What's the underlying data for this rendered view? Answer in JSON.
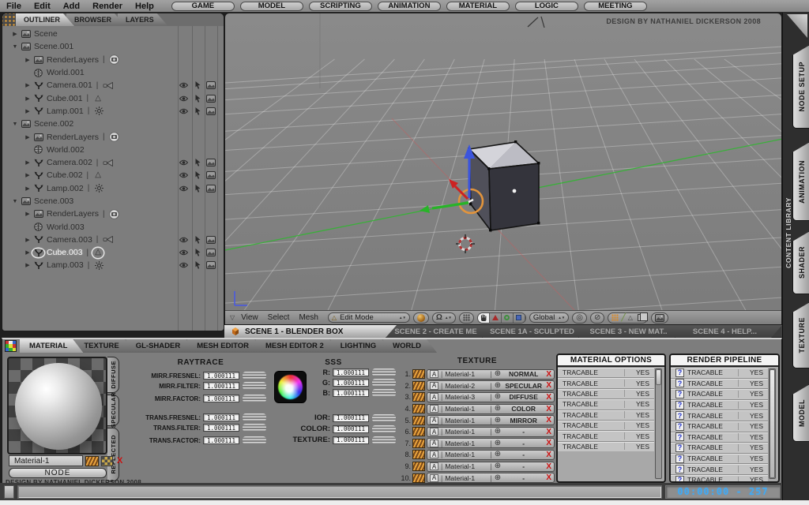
{
  "menubar": {
    "menus": [
      "File",
      "Edit",
      "Add",
      "Render",
      "Help"
    ],
    "workspace_tabs": [
      "GAME",
      "MODEL",
      "SCRIPTING",
      "ANIMATION",
      "MATERIAL",
      "LOGIC",
      "MEETING"
    ]
  },
  "outliner": {
    "tabs": [
      {
        "label": "OUTLINER",
        "active": true
      },
      {
        "label": "BROWSER",
        "active": false
      },
      {
        "label": "LAYERS",
        "active": false
      }
    ],
    "tree": [
      {
        "indent": 0,
        "arrow": "right",
        "icon": "scene",
        "label": "Scene"
      },
      {
        "indent": 0,
        "arrow": "down",
        "icon": "scene",
        "label": "Scene.001"
      },
      {
        "indent": 1,
        "arrow": "right",
        "icon": "scene",
        "label": "RenderLayers",
        "badge": "render"
      },
      {
        "indent": 1,
        "arrow": "none",
        "icon": "world",
        "label": "World.001"
      },
      {
        "indent": 1,
        "arrow": "right",
        "icon": "object",
        "label": "Camera.001",
        "type_icon": "camera",
        "columns": true
      },
      {
        "indent": 1,
        "arrow": "right",
        "icon": "object",
        "label": "Cube.001",
        "type_icon": "mesh",
        "columns": true
      },
      {
        "indent": 1,
        "arrow": "right",
        "icon": "object",
        "label": "Lamp.001",
        "type_icon": "lamp",
        "columns": true
      },
      {
        "indent": 0,
        "arrow": "down",
        "icon": "scene",
        "label": "Scene.002"
      },
      {
        "indent": 1,
        "arrow": "right",
        "icon": "scene",
        "label": "RenderLayers",
        "badge": "render"
      },
      {
        "indent": 1,
        "arrow": "none",
        "icon": "world",
        "label": "World.002"
      },
      {
        "indent": 1,
        "arrow": "right",
        "icon": "object",
        "label": "Camera.002",
        "type_icon": "camera",
        "columns": true
      },
      {
        "indent": 1,
        "arrow": "right",
        "icon": "object",
        "label": "Cube.002",
        "type_icon": "mesh",
        "columns": true
      },
      {
        "indent": 1,
        "arrow": "right",
        "icon": "object",
        "label": "Lamp.002",
        "type_icon": "lamp",
        "columns": true
      },
      {
        "indent": 0,
        "arrow": "down",
        "icon": "scene",
        "label": "Scene.003"
      },
      {
        "indent": 1,
        "arrow": "right",
        "icon": "scene",
        "label": "RenderLayers",
        "badge": "render"
      },
      {
        "indent": 1,
        "arrow": "none",
        "icon": "world",
        "label": "World.003"
      },
      {
        "indent": 1,
        "arrow": "right",
        "icon": "object",
        "label": "Camera.003",
        "type_icon": "camera",
        "columns": true
      },
      {
        "indent": 1,
        "arrow": "right",
        "icon": "object",
        "label": "Cube.003",
        "type_icon": "mesh",
        "columns": true,
        "selected": true
      },
      {
        "indent": 1,
        "arrow": "right",
        "icon": "object",
        "label": "Lamp.003",
        "type_icon": "lamp",
        "columns": true
      }
    ]
  },
  "viewport": {
    "credit": "DESIGN BY NATHANIEL DICKERSON 2008",
    "menus": [
      "View",
      "Select",
      "Mesh"
    ],
    "mode": "Edit Mode",
    "orientation": "Global"
  },
  "scene_tabs": [
    {
      "label": "SCENE 1 - BLENDER BOX",
      "active": true
    },
    {
      "label": "SCENE 2 - CREATE ME",
      "active": false
    },
    {
      "label": "SCENE 1A - SCULPTED",
      "active": false
    },
    {
      "label": "SCENE 3 - NEW MAT..",
      "active": false
    },
    {
      "label": "SCENE 4 - HELP...",
      "active": false
    }
  ],
  "properties": {
    "tabs": [
      {
        "label": "MATERIAL",
        "active": true
      },
      {
        "label": "TEXTURE",
        "active": false
      },
      {
        "label": "GL-SHADER",
        "active": false
      },
      {
        "label": "MESH EDITOR",
        "active": false
      },
      {
        "label": "MESH EDITOR 2",
        "active": false
      },
      {
        "label": "LIGHTING",
        "active": false
      },
      {
        "label": "WORLD",
        "active": false
      }
    ]
  },
  "preview": {
    "material_name": "Material-1",
    "node_label": "NODE",
    "side_tabs": [
      "DIFFUSE",
      "SPECULAR",
      "REFLECTED"
    ],
    "delete_label": "X",
    "credit": "DESIGN BY NATHANIEL DICKERSON 2008"
  },
  "raytrace": {
    "title": "RAYTRACE",
    "groups": [
      [
        {
          "label": "MIRR.FRESNEL:",
          "value": "1.000111"
        },
        {
          "label": "MIRR.FILTER:",
          "value": "1.000111"
        },
        {
          "label": "MIRR.FACTOR:",
          "value": "1.000111"
        }
      ],
      [
        {
          "label": "TRANS.FRESNEL:",
          "value": "1.000111"
        },
        {
          "label": "TRANS.FILTER:",
          "value": "1.000111"
        },
        {
          "label": "TRANS.FACTOR:",
          "value": "1.000111"
        }
      ]
    ]
  },
  "sss": {
    "title": "SSS",
    "rgb_rows": [
      {
        "label": "R:",
        "value": "1.000111"
      },
      {
        "label": "G:",
        "value": "1.000111"
      },
      {
        "label": "B:",
        "value": "1.000111"
      }
    ],
    "extra_rows": [
      {
        "label": "IOR:",
        "value": "1.000111"
      },
      {
        "label": "COLOR:",
        "value": "1.000111"
      },
      {
        "label": "TEXTURE:",
        "value": "1.000111"
      }
    ]
  },
  "texture_list": {
    "title": "TEXTURE",
    "channel": "A",
    "target_icon": "⊕",
    "delete_label": "X",
    "rows": [
      {
        "num": "1.",
        "name": "Material-1",
        "type": "NORMAL"
      },
      {
        "num": "2.",
        "name": "Material-2",
        "type": "SPECULAR"
      },
      {
        "num": "3.",
        "name": "Material-3",
        "type": "DIFFUSE"
      },
      {
        "num": "4.",
        "name": "Material-1",
        "type": "COLOR"
      },
      {
        "num": "5.",
        "name": "Material-1",
        "type": "MIRROR"
      },
      {
        "num": "6.",
        "name": "Material-1",
        "type": "-"
      },
      {
        "num": "7.",
        "name": "Material-1",
        "type": "-"
      },
      {
        "num": "8.",
        "name": "Material-1",
        "type": "-"
      },
      {
        "num": "9.",
        "name": "Material-1",
        "type": "-"
      },
      {
        "num": "10.",
        "name": "Material-1",
        "type": "-"
      }
    ]
  },
  "material_options": {
    "title": "MATERIAL OPTIONS",
    "rows": [
      {
        "label": "TRACABLE",
        "value": "YES"
      },
      {
        "label": "TRACABLE",
        "value": "YES"
      },
      {
        "label": "TRACABLE",
        "value": "YES"
      },
      {
        "label": "TRACABLE",
        "value": "YES"
      },
      {
        "label": "TRACABLE",
        "value": "YES"
      },
      {
        "label": "TRACABLE",
        "value": "YES"
      },
      {
        "label": "TRACABLE",
        "value": "YES"
      },
      {
        "label": "TRACABLE",
        "value": "YES"
      }
    ]
  },
  "render_pipeline": {
    "title": "RENDER PIPELINE",
    "icon": "?",
    "rows": [
      {
        "label": "TRACABLE",
        "value": "YES"
      },
      {
        "label": "TRACABLE",
        "value": "YES"
      },
      {
        "label": "TRACABLE",
        "value": "YES"
      },
      {
        "label": "TRACABLE",
        "value": "YES"
      },
      {
        "label": "TRACABLE",
        "value": "YES"
      },
      {
        "label": "TRACABLE",
        "value": "YES"
      },
      {
        "label": "TRACABLE",
        "value": "YES"
      },
      {
        "label": "TRACABLE",
        "value": "YES"
      },
      {
        "label": "TRACABLE",
        "value": "YES"
      },
      {
        "label": "TRACABLE",
        "value": "YES"
      },
      {
        "label": "TRACABLE",
        "value": "YES"
      }
    ]
  },
  "sidebar": {
    "label": "CONTENT LIBRARY",
    "tabs": [
      "NODE SETUP",
      "ANIMATION",
      "SHADER",
      "TEXTURE",
      "MODEL"
    ]
  },
  "statusbar": {
    "time": "00:00:00 - 257"
  },
  "colors": {
    "lcd_blue": "#3fa9f5",
    "delete_red": "#cc1111",
    "texture_orange": "#e8a33d",
    "axis_green": "#28b428",
    "axis_blue": "#3c55dd",
    "axis_red": "#cc2222",
    "gizmo_orange": "#e2943c"
  }
}
